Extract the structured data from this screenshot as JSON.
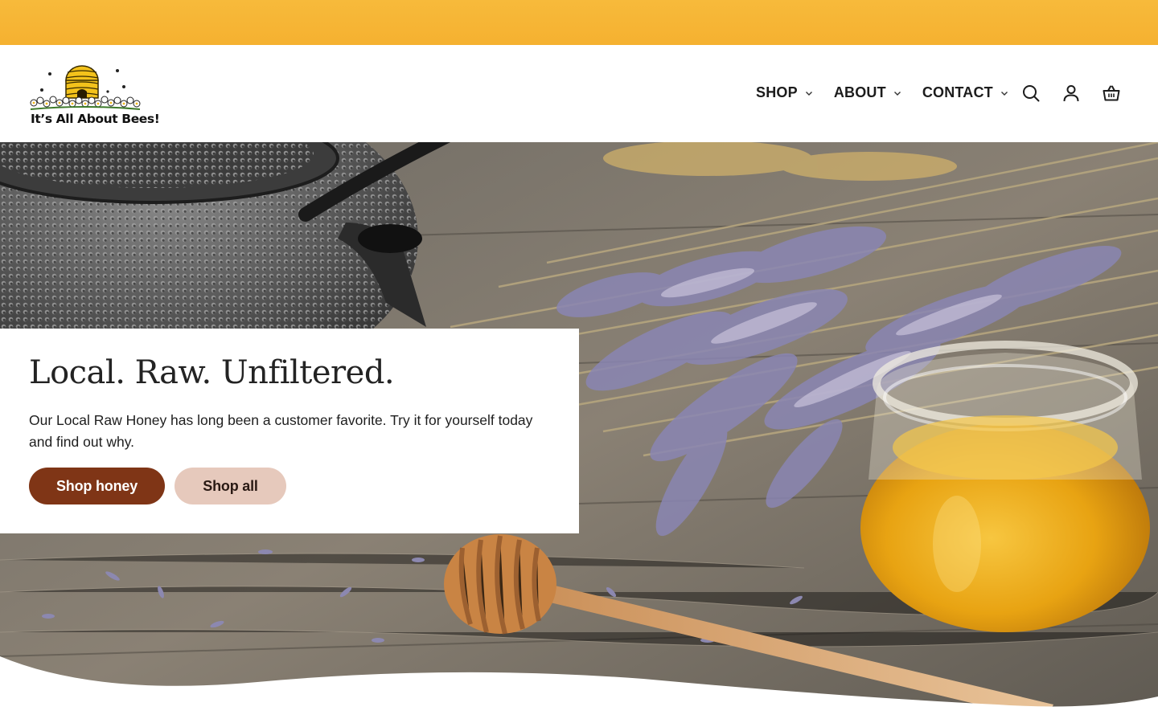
{
  "brand": {
    "name": "It’s All About Bees!",
    "colors": {
      "announcement": "#f6b434",
      "primary_button": "#7f3516",
      "secondary_button": "#e6c9bc"
    }
  },
  "nav": {
    "items": [
      {
        "label": "SHOP",
        "icon": "chevron-down-icon"
      },
      {
        "label": "ABOUT",
        "icon": "chevron-down-icon"
      },
      {
        "label": "CONTACT",
        "icon": "chevron-down-icon"
      }
    ],
    "icons": [
      "search-icon",
      "account-icon",
      "cart-basket-icon"
    ]
  },
  "hero": {
    "heading": "Local. Raw. Unfiltered.",
    "body": "Our Local Raw Honey has long been a customer favorite. Try it for yourself today and find out why.",
    "primary_button": "Shop honey",
    "secondary_button": "Shop all"
  }
}
